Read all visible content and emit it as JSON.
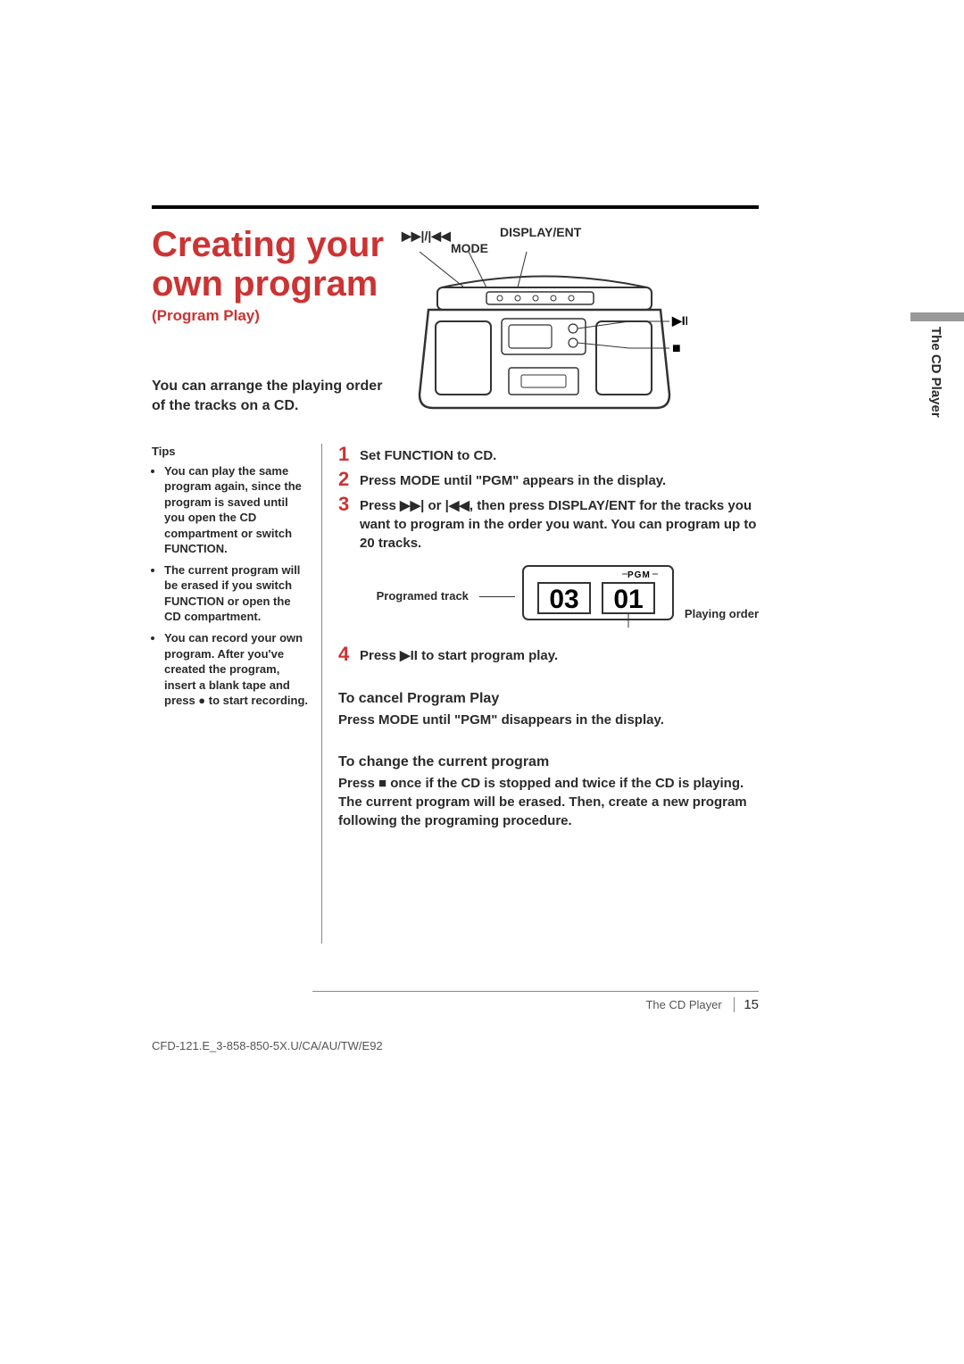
{
  "header": {
    "title_line1": "Creating your",
    "title_line2": "own program",
    "subtitle": "(Program Play)",
    "intro": "You can arrange the playing order of the tracks on a CD."
  },
  "diagram": {
    "label_ffrew": "▶▶|/|◀◀",
    "label_display": "DISPLAY/ENT",
    "label_mode": "MODE",
    "callout_play": "▶II",
    "callout_stop": "■"
  },
  "side_tab": "The CD Player",
  "tips": {
    "heading": "Tips",
    "items": [
      "You can play the same program again, since the program is saved until you open the CD compartment or switch FUNCTION.",
      "The current program will be erased if you switch FUNCTION or open the CD compartment.",
      "You can record your own program. After you've created the program, insert a blank tape and press ● to start recording."
    ]
  },
  "steps": {
    "s1": "Set FUNCTION to CD.",
    "s2": "Press MODE until \"PGM\" appears in the display.",
    "s3": "Press ▶▶| or |◀◀, then press DISPLAY/ENT for the tracks you want to program in the order you want. You can program up to 20 tracks.",
    "s4": "Press ▶II to start program play."
  },
  "lcd": {
    "left_caption": "Programed track",
    "right_caption": "Playing order",
    "pgm_label": "PGM",
    "left_digits": "03",
    "right_digits": "01"
  },
  "sections": {
    "cancel_head": "To cancel Program Play",
    "cancel_body": "Press MODE until \"PGM\" disappears in the display.",
    "change_head": "To change the current program",
    "change_body": "Press ■ once if the CD is stopped and twice if the CD is playing. The current program will be erased. Then, create a new program following the programing procedure."
  },
  "footer": {
    "section": "The CD Player",
    "page": "15",
    "doc_code": "CFD-121.E_3-858-850-5X.U/CA/AU/TW/E92"
  }
}
